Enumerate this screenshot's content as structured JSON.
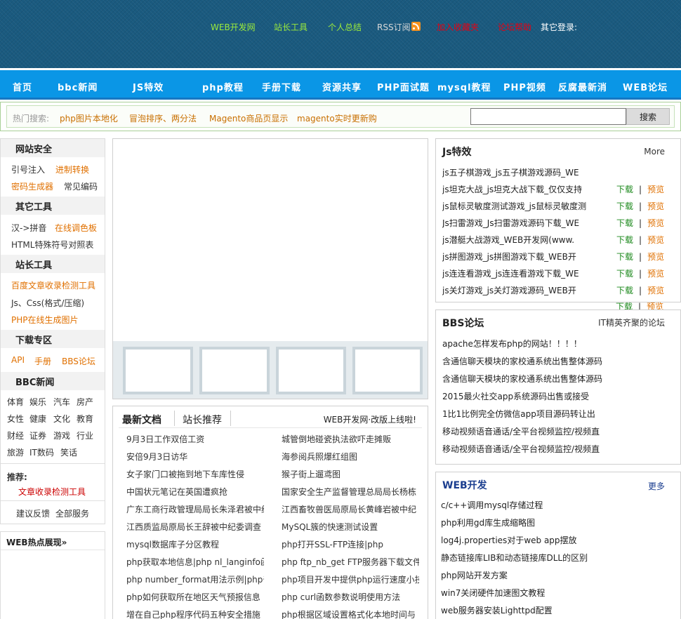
{
  "header": {
    "links": [
      {
        "label": "WEB开发网",
        "color": "#9bea3c"
      },
      {
        "label": "站长工具",
        "color": "#9bea3c"
      },
      {
        "label": "个人总结",
        "color": "#9bea3c"
      },
      {
        "label": "RSS订阅",
        "color": "#d9d9d9"
      },
      {
        "label": "加入收藏夹",
        "color": "#e60012"
      },
      {
        "label": "论坛帮助",
        "color": "#e60012"
      }
    ],
    "other_login": "其它登录:"
  },
  "nav": [
    "首页",
    "bbc新闻",
    "JS特效",
    "php教程",
    "手册下载",
    "资源共享",
    "PHP面试题",
    "mysql教程",
    "PHP视频",
    "反腐最新消",
    "WEB论坛"
  ],
  "search": {
    "hot_label": "热门搜索:",
    "hot_links": [
      "php图片本地化",
      "冒泡排序、两分法",
      "Magento商品页显示",
      "magento实时更新购"
    ],
    "input_value": "",
    "button": "搜索"
  },
  "left": {
    "sections": [
      {
        "title": "网站安全",
        "items": [
          {
            "label": "引号注入",
            "color": "dark"
          },
          {
            "label": "进制转换",
            "color": "orange"
          },
          {
            "label": "密码生成器",
            "color": "orange"
          },
          {
            "label": "常见编码",
            "color": "dark"
          }
        ]
      },
      {
        "title": "其它工具",
        "items": [
          {
            "label": "汉->拼音",
            "color": "dark"
          },
          {
            "label": "在线调色板",
            "color": "orange"
          },
          {
            "label": "HTML特殊符号对照表",
            "color": "dark"
          }
        ]
      },
      {
        "title": "站长工具",
        "items": [
          {
            "label": "百度文章收录检测工具",
            "color": "orange"
          },
          {
            "label": "Js、Css(格式/压缩)",
            "color": "dark"
          },
          {
            "label": "PHP在线生成图片",
            "color": "orange"
          }
        ]
      },
      {
        "title": "下载专区",
        "items": [
          {
            "label": "API",
            "color": "orange"
          },
          {
            "label": "手册",
            "color": "orange"
          },
          {
            "label": "BBS论坛",
            "color": "orange"
          }
        ]
      },
      {
        "title": "BBC新闻",
        "items": [
          {
            "label": "体育"
          },
          {
            "label": "娱乐"
          },
          {
            "label": "汽车"
          },
          {
            "label": "房产"
          },
          {
            "label": "女性"
          },
          {
            "label": "健康"
          },
          {
            "label": "文化"
          },
          {
            "label": "教育"
          },
          {
            "label": "财经"
          },
          {
            "label": "证券"
          },
          {
            "label": "游戏"
          },
          {
            "label": "行业"
          },
          {
            "label": "旅游"
          },
          {
            "label": "IT数码"
          },
          {
            "label": "笑话"
          }
        ]
      }
    ],
    "recommend_label": "推荐:",
    "recommend_link": "文章收录检测工具",
    "feedback": "建议反馈",
    "all_services": "全部服务",
    "hot_title": "WEB热点展现»"
  },
  "docs": {
    "tab_latest": "最新文档",
    "tab_recommend": "站长推荐",
    "notice": "WEB开发网·改版上线啦!",
    "left": [
      "9月3日工作双倍工资",
      "安倍9月3日访华",
      "女子家门口被拖到地下车库性侵",
      "中国状元笔记在英国遭疯抢",
      "广东工商行政管理局局长朱泽君被中纪",
      "江西质监局原局长王辞被中纪委调查",
      "mysql数据库子分区教程",
      "php获取本地信息|php nl_langinfo函",
      "php number_format用法示例|php千",
      "php如何获取所在地区天气预报信息",
      "增在自己php程序代码五种安全措施"
    ],
    "right": [
      "城管倒地碰瓷执法欲吓走摊贩",
      "海参阅兵照爆红组图",
      "猴子街上遛鸢图",
      "国家安全生产监督管理总局局长杨栋",
      "江西畜牧兽医局原局长黄峰岩被中纪",
      "MySQL簇的快速测试设置",
      "php打开SSL-FTP连接|php",
      "php ftp_nb_get FTP服务器下载文件",
      "php项目开发中提供php运行速度小技",
      "php curl函数参数说明使用方法",
      "php根据区域设置格式化本地时间与"
    ]
  },
  "js_panel": {
    "title": "Js特效",
    "more": "More",
    "download": "下载",
    "separator": "|",
    "preview": "预览",
    "items": [
      "js五子棋游戏_js五子棋游戏源码_WE",
      "js坦克大战_js坦克大战下载_仅仅支持",
      "js鼠标灵敏度测试游戏_js鼠标灵敏度测",
      "Js扫雷游戏_Js扫雷游戏源码下载_WE",
      "js潜艇大战游戏_WEB开发网(www.",
      "js拼图游戏_js拼图游戏下载_WEB开",
      "js连连看游戏_js连连看游戏下载_WE",
      "js关灯游戏_js关灯游戏源码_WEB开"
    ]
  },
  "bbs_panel": {
    "title": "BBS论坛",
    "tagline": "IT精英齐聚的论坛",
    "items": [
      "apache怎样发布php的网站！！！！",
      "含通信聊天模块的家校通系统出售整体源码",
      "含通信聊天模块的家校通系统出售整体源码",
      "2015最火社交app系统源码出售或接受",
      "1比1比例完全仿微信app项目源码转让出",
      "移动视频语音通话/全平台视频监控/视频直",
      "移动视频语音通话/全平台视频监控/视频直"
    ]
  },
  "web_panel": {
    "title": "WEB开发",
    "more": "更多",
    "title_color": "#1a3d8f",
    "items": [
      "c/c++调用mysql存储过程",
      "php利用gd库生成缩略图",
      "log4j.properties对于web app摆放",
      "静态链接库LIB和动态链接库DLL的区别",
      "php网站开发方案",
      "win7关闭硬件加速图文教程",
      "web服务器安装Lighttpd配置"
    ]
  }
}
